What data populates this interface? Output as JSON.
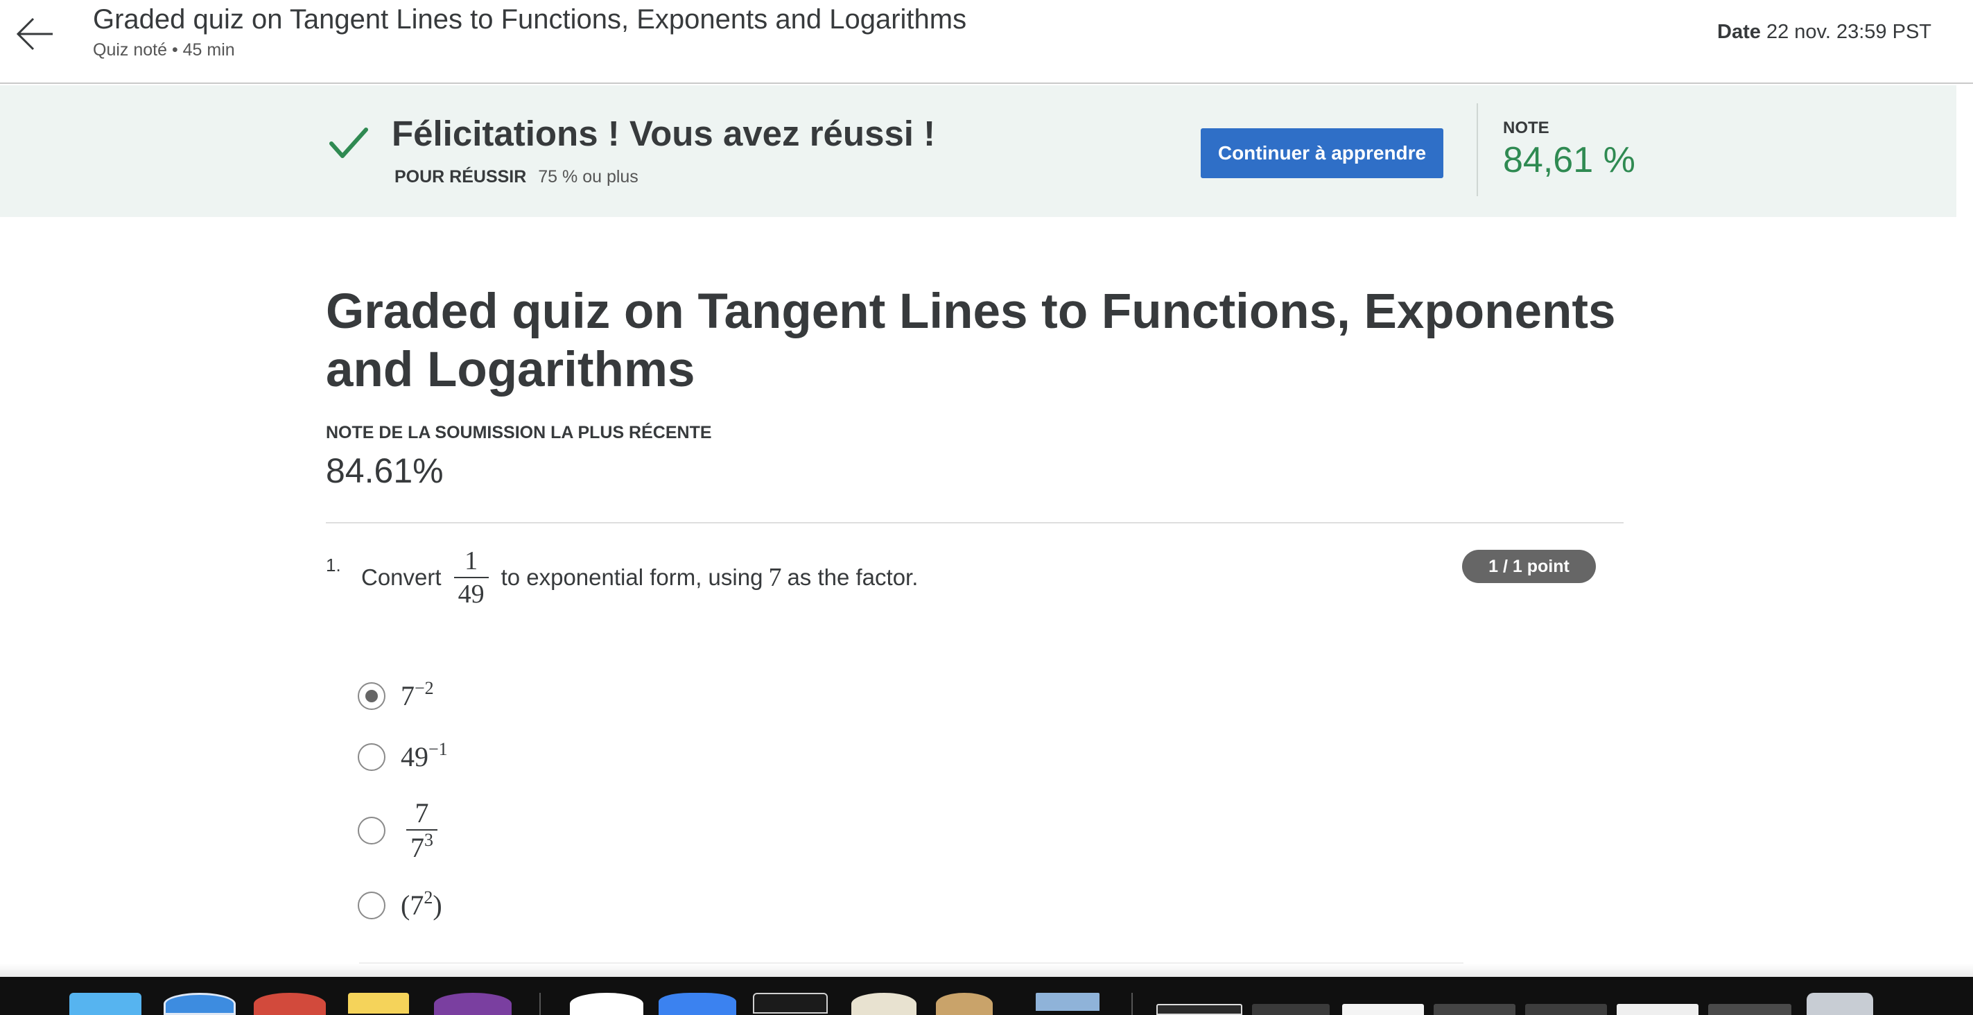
{
  "header": {
    "title": "Graded quiz on Tangent Lines to Functions, Exponents and Logarithms",
    "subtitle": "Quiz noté • 45  min",
    "date_label": "Date",
    "date_value": "22 nov. 23:59 PST"
  },
  "banner": {
    "title": "Félicitations ! Vous avez réussi !",
    "pass_label": "POUR RÉUSSIR",
    "pass_value": "75 % ou plus",
    "continue_label": "Continuer à apprendre",
    "grade_label": "NOTE",
    "grade_value": "84,61 %",
    "success_color": "#2f8a52",
    "button_color": "#2f6fc7"
  },
  "main": {
    "title": "Graded quiz on Tangent Lines to Functions, Exponents and Logarithms",
    "recent_label": "NOTE DE LA SOUMISSION LA PLUS RÉCENTE",
    "recent_value": "84.61%"
  },
  "question": {
    "number": "1.",
    "text_before": "Convert",
    "fraction_numerator": "1",
    "fraction_denominator": "49",
    "text_middle": "to exponential form, using",
    "factor": "7",
    "text_after": "as the factor.",
    "points": "1 / 1 point",
    "options": [
      {
        "base": "7",
        "exponent": "−2",
        "selected": true
      },
      {
        "base": "49",
        "exponent": "−1",
        "selected": false
      },
      {
        "numerator": "7",
        "denominator_base": "7",
        "denominator_exponent": "3",
        "selected": false
      },
      {
        "open": "(",
        "base": "7",
        "exponent": "2",
        "close": ")",
        "selected": false
      }
    ]
  },
  "icons": {
    "back": "arrow-left-icon",
    "success": "checkmark-icon"
  }
}
